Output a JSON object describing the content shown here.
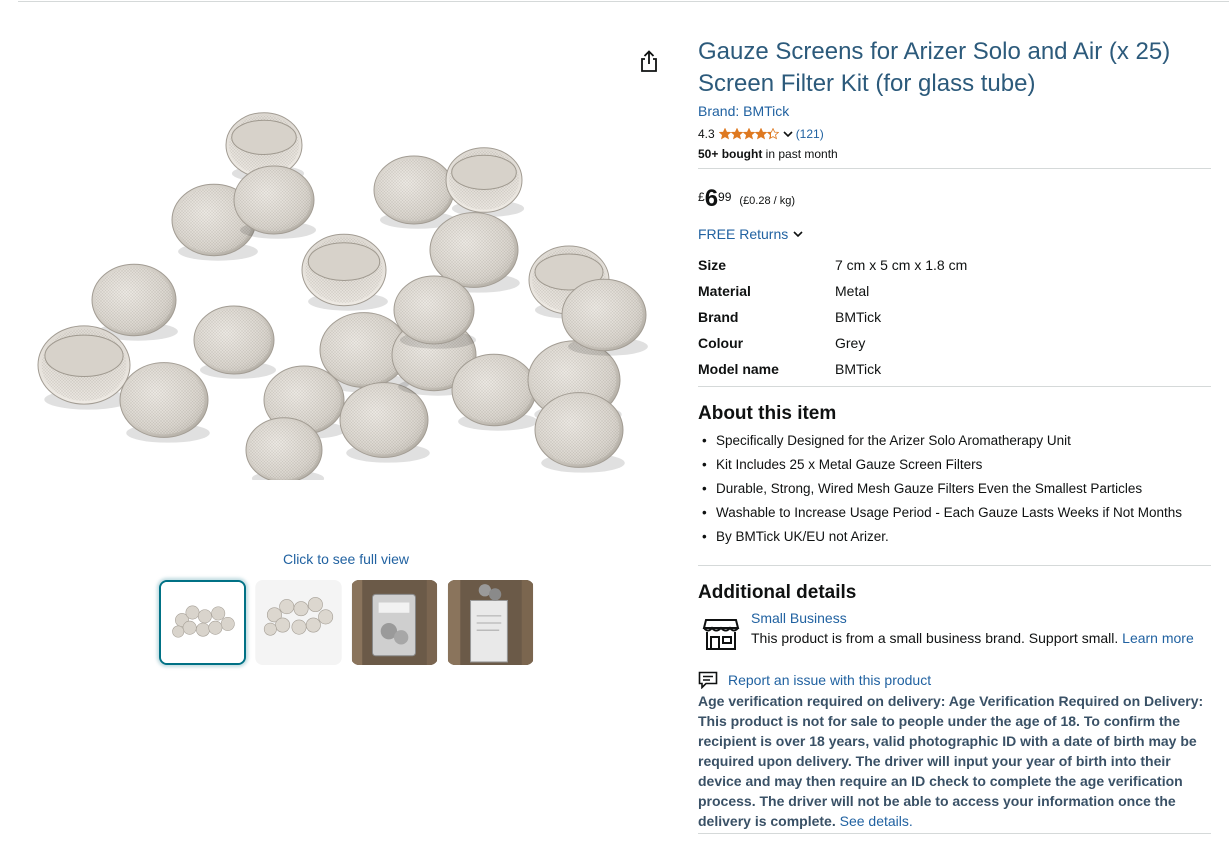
{
  "product": {
    "title": "Gauze Screens for Arizer Solo and Air (x 25) Screen Filter Kit (for glass tube)",
    "brand_link": "Brand: BMTick",
    "rating": "4.3",
    "rating_stars": 4.3,
    "review_count": "(121)",
    "bought_bold": "50+ bought",
    "bought_rest": " in past month"
  },
  "price": {
    "currency": "£",
    "whole": "6",
    "fraction": "99",
    "unit_price": "(£0.28 / kg)"
  },
  "returns_label": "FREE Returns",
  "specs": [
    {
      "key": "Size",
      "value": "7 cm x 5 cm x 1.8 cm"
    },
    {
      "key": "Material",
      "value": "Metal"
    },
    {
      "key": "Brand",
      "value": "BMTick"
    },
    {
      "key": "Colour",
      "value": "Grey"
    },
    {
      "key": "Model name",
      "value": "BMTick"
    }
  ],
  "about": {
    "heading": "About this item",
    "bullets": [
      "Specifically Designed for the Arizer Solo Aromatherapy Unit",
      "Kit Includes 25 x Metal Gauze Screen Filters",
      "Durable, Strong, Wired Mesh Gauze Filters Even the Smallest Particles",
      "Washable to Increase Usage Period - Each Gauze Lasts Weeks if Not Months",
      "By BMTick UK/EU not Arizer."
    ]
  },
  "additional": {
    "heading": "Additional details",
    "small_business_title": "Small Business",
    "small_business_text": "This product is from a small business brand. Support small. ",
    "learn_more": "Learn more"
  },
  "report_label": "Report an issue with this product",
  "age_notice": "Age verification required on delivery: Age Verification Required on Delivery: This product is not for sale to people under the age of 18. To confirm the recipient is over 18 years, valid photographic ID with a date of birth may be required upon delivery. The driver will input your year of birth into their device and may then require an ID check to complete the age verification process. The driver will not be able to access your information once the delivery is complete.",
  "see_details": "See details.",
  "media": {
    "full_view_label": "Click to see full view",
    "thumbnails": [
      "gauze-screens-photo",
      "gauze-screens-photo-alt",
      "packaged-bag-photo",
      "bag-in-hand-photo"
    ],
    "selected_thumbnail": 0
  },
  "colors": {
    "link": "#2162a1",
    "title": "#2c5a7b",
    "star": "#de7921",
    "thumb_selected": "#007185"
  },
  "icons": [
    "share-icon",
    "star-icon",
    "chevron-down-icon",
    "store-icon",
    "report-icon"
  ]
}
